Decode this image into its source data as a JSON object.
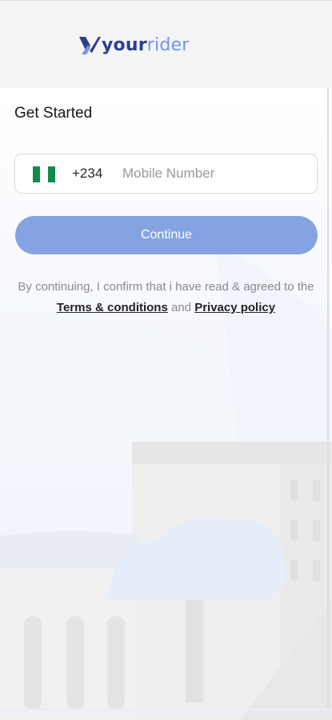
{
  "brand": {
    "name_part1": "your",
    "name_part2": "rider",
    "primary_color": "#2c3e8f",
    "accent_color": "#6f96e8"
  },
  "page": {
    "title": "Get Started"
  },
  "phone": {
    "country_flag": "nigeria-flag",
    "dial_code": "+234",
    "placeholder": "Mobile Number",
    "value": ""
  },
  "actions": {
    "continue_label": "Continue",
    "continue_color": "#85a3e3"
  },
  "consent": {
    "text": "By continuing, I confirm that i have read & agreed to the",
    "terms_label": "Terms & conditions",
    "conjunction": "and",
    "privacy_label": "Privacy policy"
  }
}
